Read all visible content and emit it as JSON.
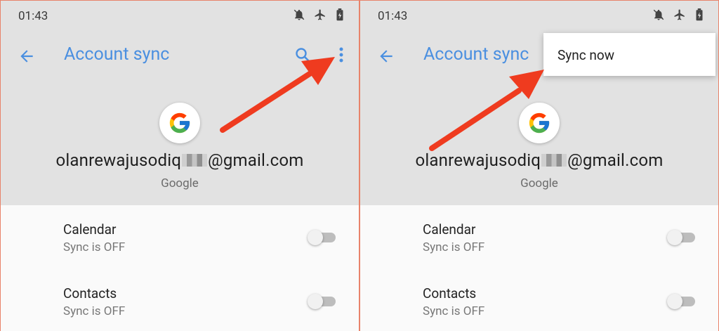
{
  "panels": [
    {
      "status_time": "01:43",
      "title": "Account sync",
      "account": {
        "email_prefix": "olanrewajusodiq",
        "email_suffix": "@gmail.com",
        "provider": "Google"
      },
      "sync_items": [
        {
          "title": "Calendar",
          "status": "Sync is OFF"
        },
        {
          "title": "Contacts",
          "status": "Sync is OFF"
        }
      ]
    },
    {
      "status_time": "01:43",
      "title": "Account sync",
      "account": {
        "email_prefix": "olanrewajusodiq",
        "email_suffix": "@gmail.com",
        "provider": "Google"
      },
      "sync_items": [
        {
          "title": "Calendar",
          "status": "Sync is OFF"
        },
        {
          "title": "Contacts",
          "status": "Sync is OFF"
        }
      ],
      "menu": {
        "items": [
          "Sync now"
        ]
      }
    }
  ],
  "icons": {
    "status": [
      "notifications-off-icon",
      "airplane-mode-icon",
      "battery-charging-icon"
    ],
    "back": "back-arrow-icon",
    "search": "search-icon",
    "more": "more-vert-icon",
    "logo": "google-logo-icon",
    "annotation": "red-arrow-icon"
  },
  "colors": {
    "accent": "#4a8fe0",
    "header_bg": "#e2e2e2",
    "body_bg": "#fafafa",
    "annotation": "#ef3b1f",
    "border": "#e8836a"
  },
  "toggles": {
    "calendar": false,
    "contacts": false
  }
}
